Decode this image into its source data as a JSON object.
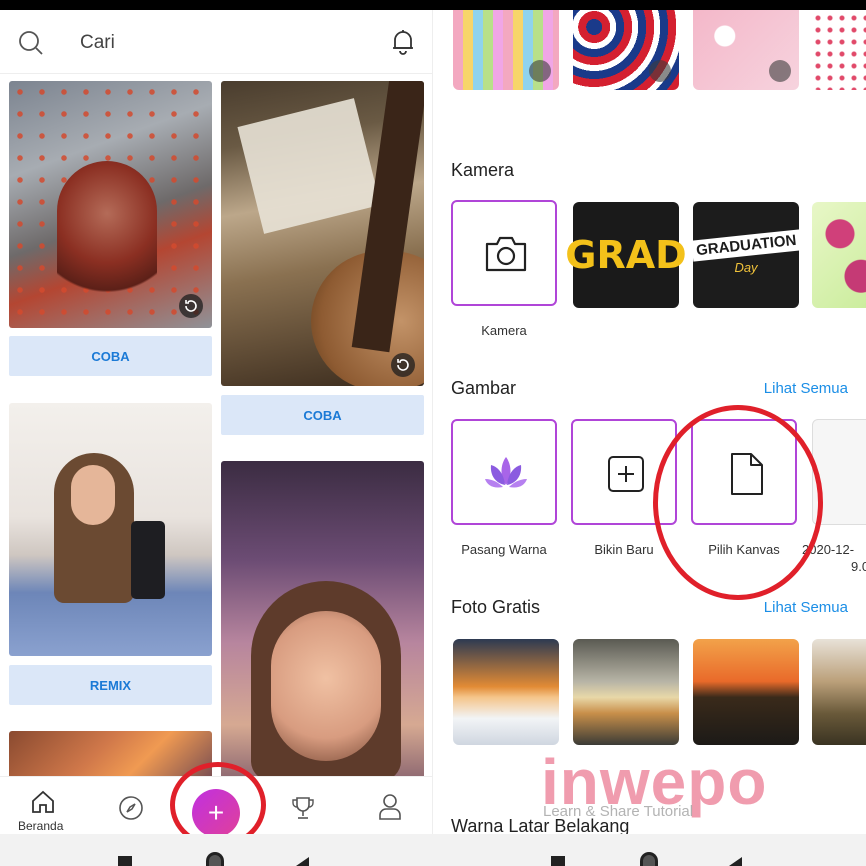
{
  "search": {
    "placeholder": "Cari"
  },
  "feed": {
    "cards": [
      {
        "button": "COBA"
      },
      {
        "button": "COBA"
      },
      {
        "button": "REMIX"
      }
    ]
  },
  "tabbar": {
    "home_label": "Beranda",
    "fab_symbol": "+"
  },
  "sections": {
    "camera": {
      "title": "Kamera",
      "tile_label": "Kamera",
      "grad_text": "GRAD",
      "graduation_text": "GRADUATION",
      "graduation_sub": "Day"
    },
    "images": {
      "title": "Gambar",
      "see_all": "Lihat Semua",
      "tiles": [
        {
          "label": "Pasang Warna"
        },
        {
          "label": "Bikin Baru"
        },
        {
          "label": "Pilih Kanvas"
        },
        {
          "label": "2020-12-"
        },
        {
          "label": "9.0"
        }
      ]
    },
    "free_photos": {
      "title": "Foto Gratis",
      "see_all": "Lihat Semua"
    },
    "background": {
      "title": "Warna Latar Belakang"
    }
  },
  "watermark": {
    "brand": "inwepo",
    "tagline": "Learn & Share Tutorial"
  },
  "colors": {
    "accent_purple": "#b045d8",
    "link_blue": "#1b8ee6",
    "button_bg": "#dbe7f8",
    "highlight_red": "#e0202a"
  }
}
